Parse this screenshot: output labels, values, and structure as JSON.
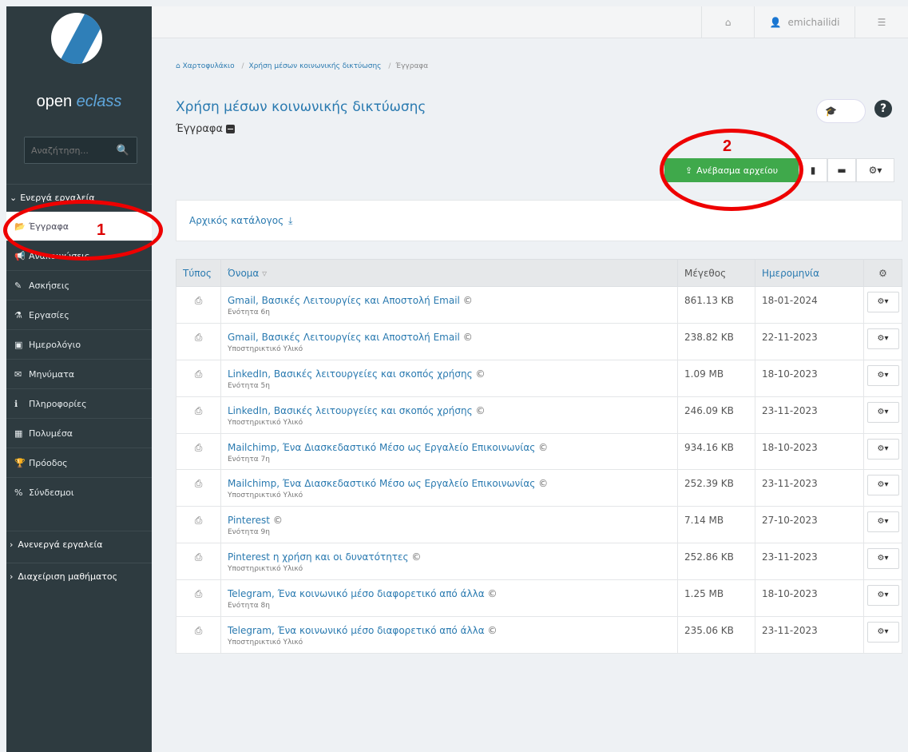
{
  "sidebar": {
    "brand_prefix": "open ",
    "brand_accent": "eclass",
    "search_placeholder": "Αναζήτηση...",
    "active_group": "Ενεργά εργαλεία",
    "items": [
      {
        "icon": "📂",
        "label": "Έγγραφα",
        "active": true
      },
      {
        "icon": "📢",
        "label": "Ανακοινώσεις"
      },
      {
        "icon": "✎",
        "label": "Ασκήσεις"
      },
      {
        "icon": "⚗",
        "label": "Εργασίες"
      },
      {
        "icon": "▣",
        "label": "Ημερολόγιο"
      },
      {
        "icon": "✉",
        "label": "Μηνύματα"
      },
      {
        "icon": "ℹ",
        "label": "Πληροφορίες"
      },
      {
        "icon": "▦",
        "label": "Πολυμέσα"
      },
      {
        "icon": "🏆",
        "label": "Πρόοδος"
      },
      {
        "icon": "%",
        "label": "Σύνδεσμοι"
      }
    ],
    "groups": [
      "Ανενεργά εργαλεία",
      "Διαχείριση μαθήματος"
    ]
  },
  "topbar": {
    "home_icon": "home-icon",
    "username": "emichailidi",
    "menu_icon": "sliders-icon"
  },
  "breadcrumb": {
    "home": "Χαρτοφυλάκιο",
    "course": "Χρήση μέσων κοινωνικής δικτύωσης",
    "current": "Έγγραφα"
  },
  "page": {
    "title": "Χρήση μέσων κοινωνικής δικτύωσης",
    "subtitle": "Έγγραφα",
    "help": "?"
  },
  "toolbar": {
    "upload_label": "Ανέβασμα αρχείου"
  },
  "annotations": {
    "one": "1",
    "two": "2"
  },
  "directory": {
    "label": "Αρχικός κατάλογος"
  },
  "table": {
    "headers": {
      "type": "Τύπος",
      "name": "Όνομα",
      "size": "Μέγεθος",
      "date": "Ημερομηνία"
    },
    "rows": [
      {
        "name": "Gmail, Βασικές Λειτουργίες και Αποστολή Email",
        "section": "Ενότητα 6η",
        "size": "861.13 KB",
        "date": "18-01-2024"
      },
      {
        "name": "Gmail, Βασικές Λειτουργίες και Αποστολή Email",
        "section": "Υποστηρικτικό Υλικό",
        "size": "238.82 KB",
        "date": "22-11-2023"
      },
      {
        "name": "LinkedIn, Βασικές λειτουργείες και σκοπός χρήσης",
        "section": "Ενότητα 5η",
        "size": "1.09 MB",
        "date": "18-10-2023"
      },
      {
        "name": "LinkedIn, Βασικές λειτουργείες και σκοπός χρήσης",
        "section": "Υποστηρικτικό Υλικό",
        "size": "246.09 KB",
        "date": "23-11-2023"
      },
      {
        "name": "Mailchimp, Ένα Διασκεδαστικό Μέσο ως Εργαλείο Επικοινωνίας",
        "section": "Ενότητα 7η",
        "size": "934.16 KB",
        "date": "18-10-2023"
      },
      {
        "name": "Mailchimp, Ένα Διασκεδαστικό Μέσο ως Εργαλείο Επικοινωνίας",
        "section": "Υποστηρικτικό Υλικό",
        "size": "252.39 KB",
        "date": "23-11-2023"
      },
      {
        "name": "Pinterest",
        "section": "Ενότητα 9η",
        "size": "7.14 MB",
        "date": "27-10-2023"
      },
      {
        "name": "Pinterest η χρήση και οι δυνατότητες",
        "section": "Υποστηρικτικό Υλικό",
        "size": "252.86 KB",
        "date": "23-11-2023"
      },
      {
        "name": "Telegram, Ένα κοινωνικό μέσο διαφορετικό από άλλα",
        "section": "Ενότητα 8η",
        "size": "1.25 MB",
        "date": "18-10-2023"
      },
      {
        "name": "Telegram, Ένα κοινωνικό μέσο διαφορετικό από άλλα",
        "section": "Υποστηρικτικό Υλικό",
        "size": "235.06 KB",
        "date": "23-11-2023"
      }
    ]
  },
  "colors": {
    "sidebar_bg": "#2e3b40",
    "link": "#2a7ab0",
    "upload_green": "#3fa94b",
    "annotation_red": "#e00000"
  }
}
